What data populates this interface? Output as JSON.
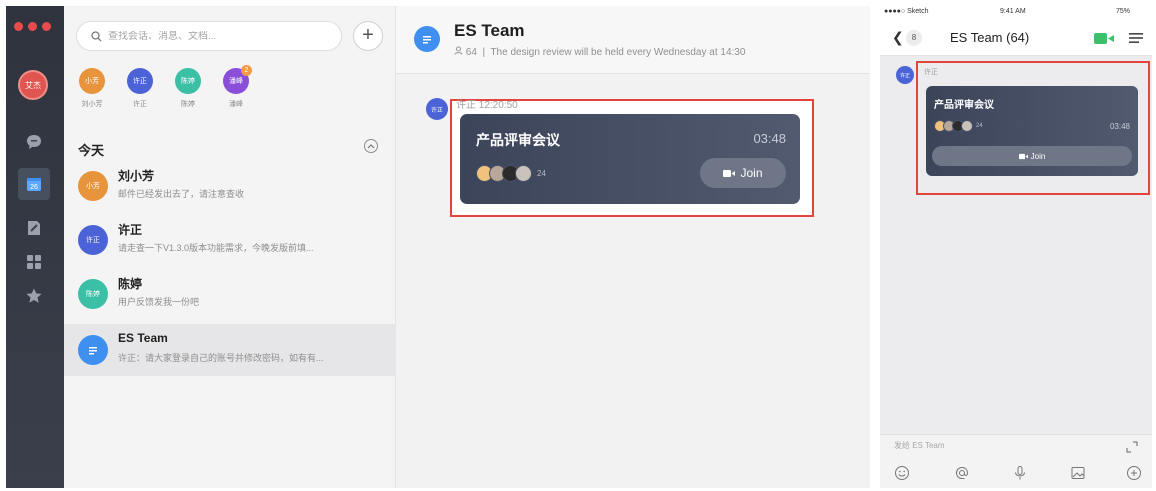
{
  "desktop": {
    "search": {
      "placeholder": "查找会话、消息、文档..."
    },
    "rail": {
      "profile_avatar_text": "艾杰",
      "calendar_day": "26"
    },
    "favorites": [
      {
        "avatar": "小芳",
        "name": "刘小芳",
        "color": "#e8943c"
      },
      {
        "avatar": "许正",
        "name": "许正",
        "color": "#4b63d6"
      },
      {
        "avatar": "陈婷",
        "name": "陈婷",
        "color": "#3bbfa5"
      },
      {
        "avatar": "潘峰",
        "name": "潘峰",
        "color": "#8a4ed8",
        "badge": "2"
      }
    ],
    "section_title": "今天",
    "conversations": [
      {
        "avatar": "小芳",
        "title": "刘小芳",
        "preview": "邮件已经发出去了，请注意查收",
        "color": "#e8943c"
      },
      {
        "avatar": "许正",
        "title": "许正",
        "preview": "请走查一下V1.3.0版本功能需求，今晚发版前填...",
        "color": "#4b63d6"
      },
      {
        "avatar": "陈婷",
        "title": "陈婷",
        "preview": "用户反馈发我一份吧",
        "color": "#3bbfa5"
      },
      {
        "avatar": "",
        "title": "ES Team",
        "preview": "许正：请大家登录自己的账号并修改密码，如有有...",
        "color": "#3f8ff0"
      }
    ],
    "chat": {
      "title": "ES Team",
      "member_count": "64",
      "announcement": "The design review will be held every Wednesday at 14:30",
      "message": {
        "sender_avatar": "许正",
        "sender": "许正",
        "time": "12:20:50",
        "meeting_title": "产品评审会议",
        "duration": "03:48",
        "participants": "24",
        "join_label": "Join"
      }
    }
  },
  "mobile": {
    "status": {
      "carrier": "●●●●○ Sketch",
      "time": "9:41 AM",
      "battery": "75%"
    },
    "back_count": "8",
    "title": "ES Team  (64)",
    "message": {
      "sender_avatar": "许正",
      "sender": "许正",
      "meeting_title": "产品评审会议",
      "participants": "24",
      "duration": "03:48",
      "join_label": "Join"
    },
    "input_placeholder": "发给 ES Team"
  },
  "colors": {
    "highlight": "#e2453c",
    "card": "#444c61",
    "accent": "#3f8ff0"
  }
}
